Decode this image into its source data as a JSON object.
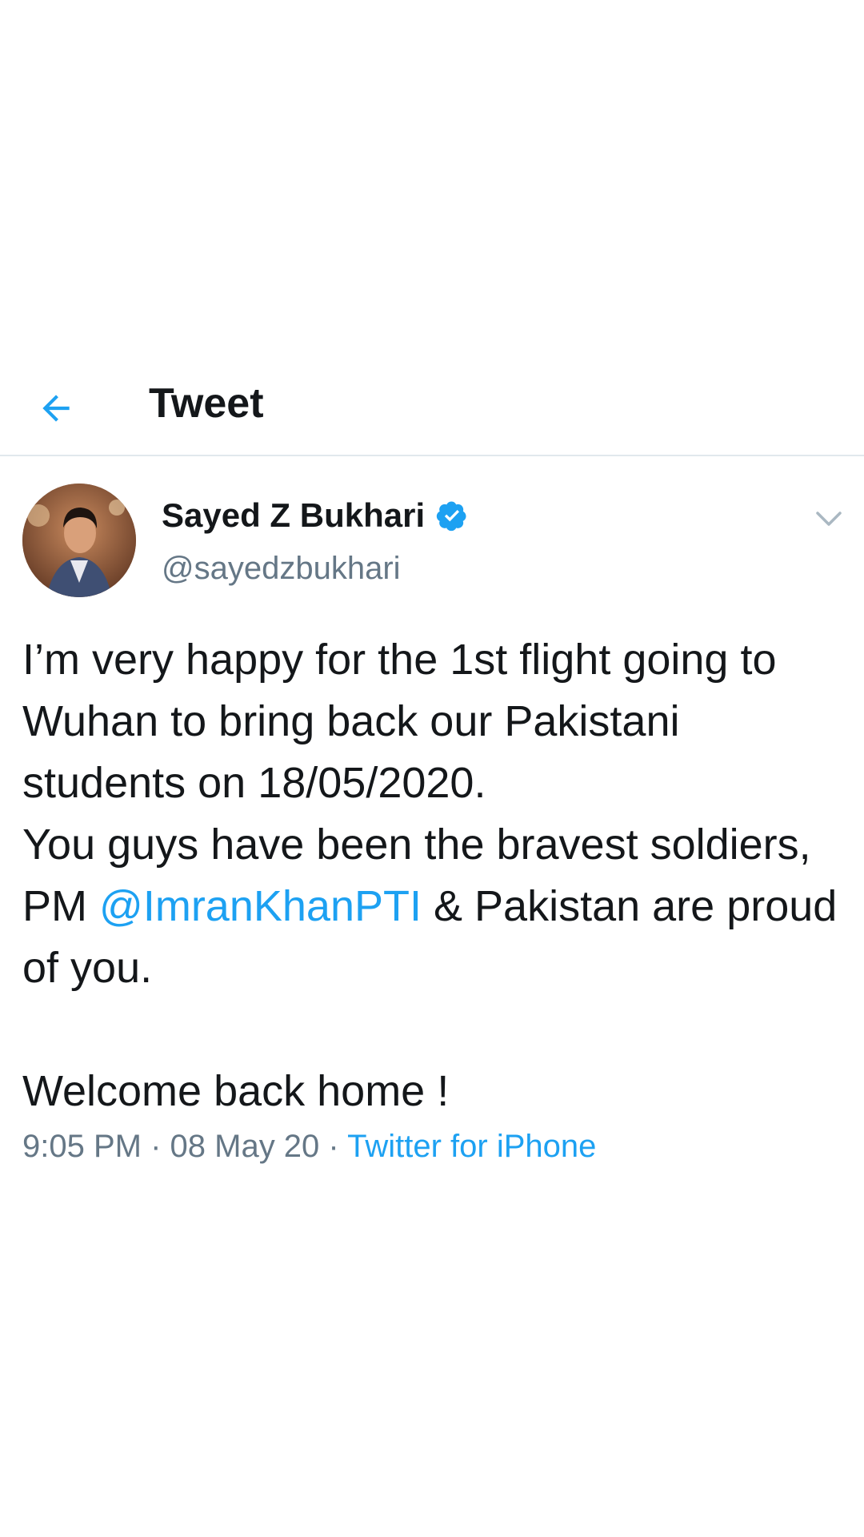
{
  "header": {
    "title": "Tweet",
    "back_icon": "back-arrow-icon",
    "accent_color": "#1da1f2"
  },
  "author": {
    "name": "Sayed Z Bukhari",
    "handle": "@sayedzbukhari",
    "verified_icon": "verified-badge-icon",
    "avatar": "avatar-photo"
  },
  "tweet": {
    "line1": "I’m very happy for the 1st flight going to Wuhan to bring back our Pakistani students on 18/05/2020.",
    "line2_before": "You guys have been the bravest soldiers, PM ",
    "mention": "@ImranKhanPTI",
    "line2_after": " & Pakistan are proud of you.",
    "line3": "Welcome back home !"
  },
  "meta": {
    "time": "9:05 PM",
    "sep1": " · ",
    "date": "08 May 20",
    "sep2": " · ",
    "source": "Twitter for iPhone"
  },
  "more_icon": "chevron-down-icon"
}
